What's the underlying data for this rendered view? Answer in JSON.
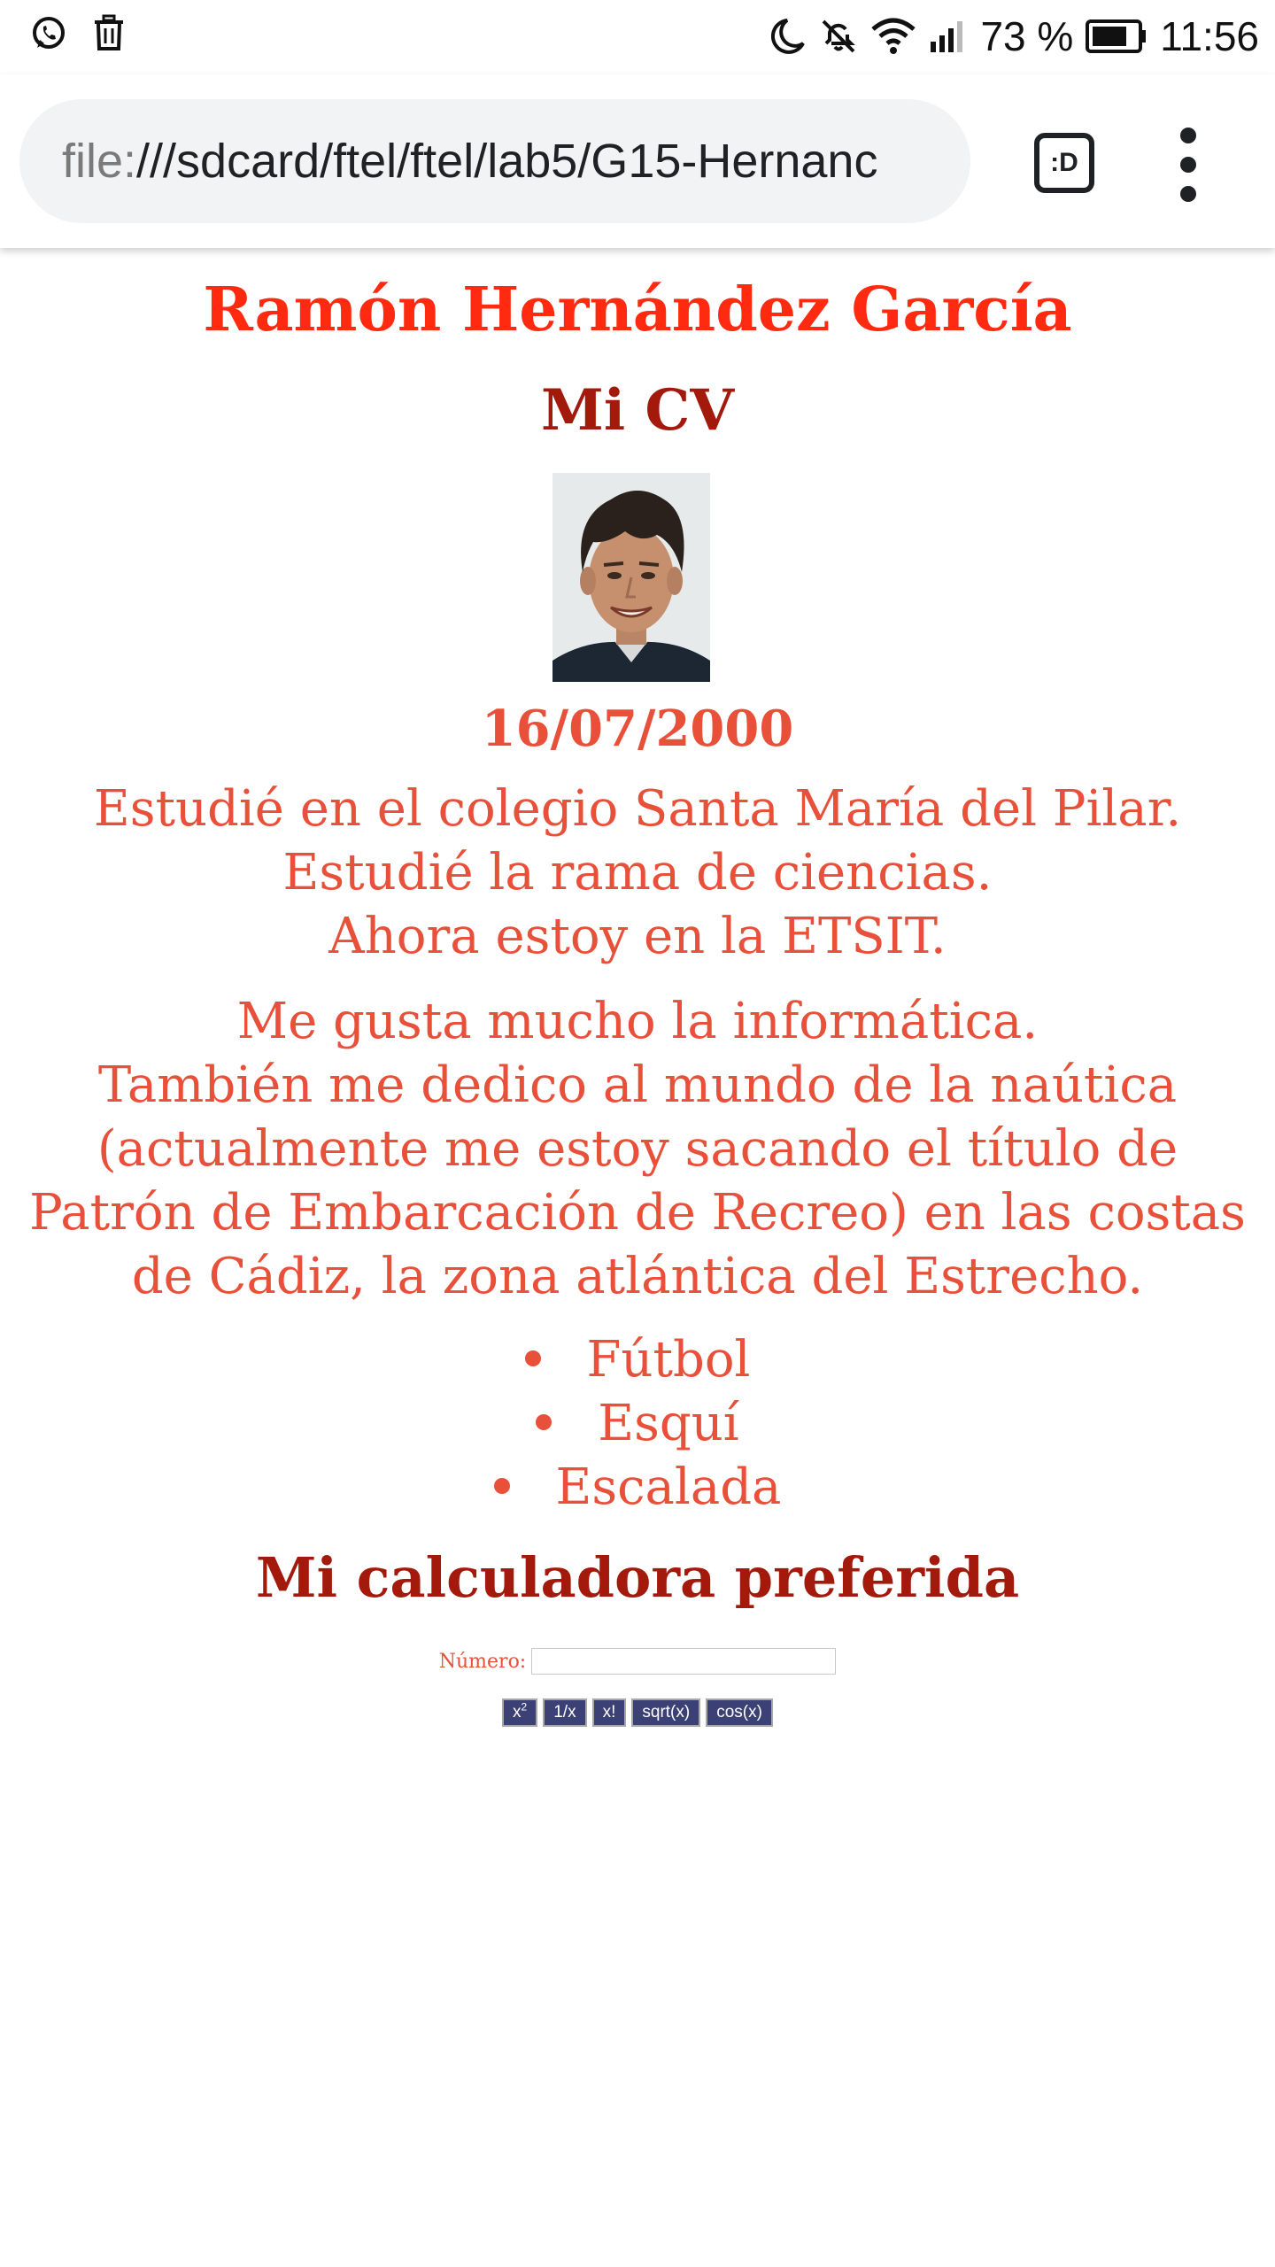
{
  "status_bar": {
    "left_icons": [
      "whatsapp-icon",
      "trash-icon"
    ],
    "right_icons": [
      "moon-icon",
      "mute-icon",
      "wifi-icon",
      "signal-icon",
      "battery-icon"
    ],
    "battery_percent": "73 %",
    "time": "11:56"
  },
  "browser": {
    "url_scheme": "file:",
    "url_rest": "///sdcard/ftel/ftel/lab5/G15-Hernanc",
    "tab_switcher_label": ":D",
    "menu_icon": "more-vert-icon"
  },
  "page": {
    "name": "Ramón Hernández García",
    "cv_title": "Mi CV",
    "photo": "profile-photo",
    "birth_date": "16/07/2000",
    "studies": [
      "Estudié en el colegio Santa María del Pilar.",
      "Estudié la rama de ciencias.",
      "Ahora estoy en la ETSIT."
    ],
    "interests": [
      "Me gusta mucho la informática.",
      "También me dedico al mundo de la naútica",
      "(actualmente me estoy sacando el título de",
      "Patrón de Embarcación de Recreo) en las costas",
      "de Cádiz, la zona atlántica del Estrecho."
    ],
    "hobbies": [
      "Fútbol",
      "Esquí",
      "Escalada"
    ]
  },
  "calculator": {
    "title": "Mi calculadora preferida",
    "number_label": "Número:",
    "number_value": "",
    "buttons": {
      "square_base": "x",
      "square_exp": "2",
      "inverse": "1/x",
      "factorial": "x!",
      "sqrt": "sqrt(x)",
      "cos": "cos(x)"
    }
  },
  "colors": {
    "name": "#ff2a10",
    "heading_dark": "#a31a0c",
    "body_text": "#e8503a",
    "button_bg": "#3b4175"
  }
}
